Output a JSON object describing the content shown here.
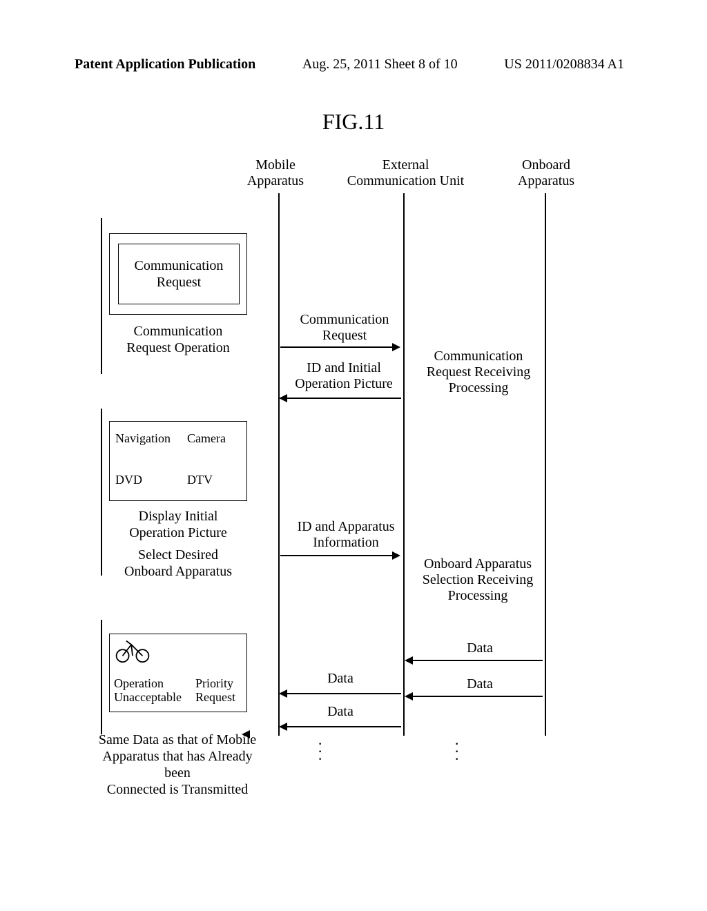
{
  "header": {
    "left": "Patent Application Publication",
    "mid": "Aug. 25, 2011  Sheet 8 of 10",
    "right": "US 2011/0208834 A1"
  },
  "figureTitle": "FIG.11",
  "lanes": {
    "mobile": "Mobile\nApparatus",
    "external": "External\nCommunication Unit",
    "onboard": "Onboard\nApparatus"
  },
  "screen1": {
    "innerLabel": "Communication\nRequest",
    "caption": "Communication\nRequest Operation"
  },
  "messages": {
    "commRequest": "Communication\nRequest",
    "idInitial": "ID and Initial\nOperation Picture",
    "commRecv": "Communication\nRequest Receiving\nProcessing",
    "idAppInfo": "ID and Apparatus\nInformation",
    "selRecv": "Onboard Apparatus\nSelection Receiving\nProcessing",
    "data": "Data"
  },
  "screen2": {
    "items": [
      "Navigation",
      "Camera",
      "DVD",
      "DTV"
    ],
    "caption1": "Display Initial\nOperation Picture",
    "caption2": "Select Desired\nOnboard Apparatus"
  },
  "screen3": {
    "opUnacceptable": "Operation\nUnacceptable",
    "priorityReq": "Priority\nRequest",
    "caption": "Same Data as that of Mobile\nApparatus that has Already been\nConnected is Transmitted"
  }
}
